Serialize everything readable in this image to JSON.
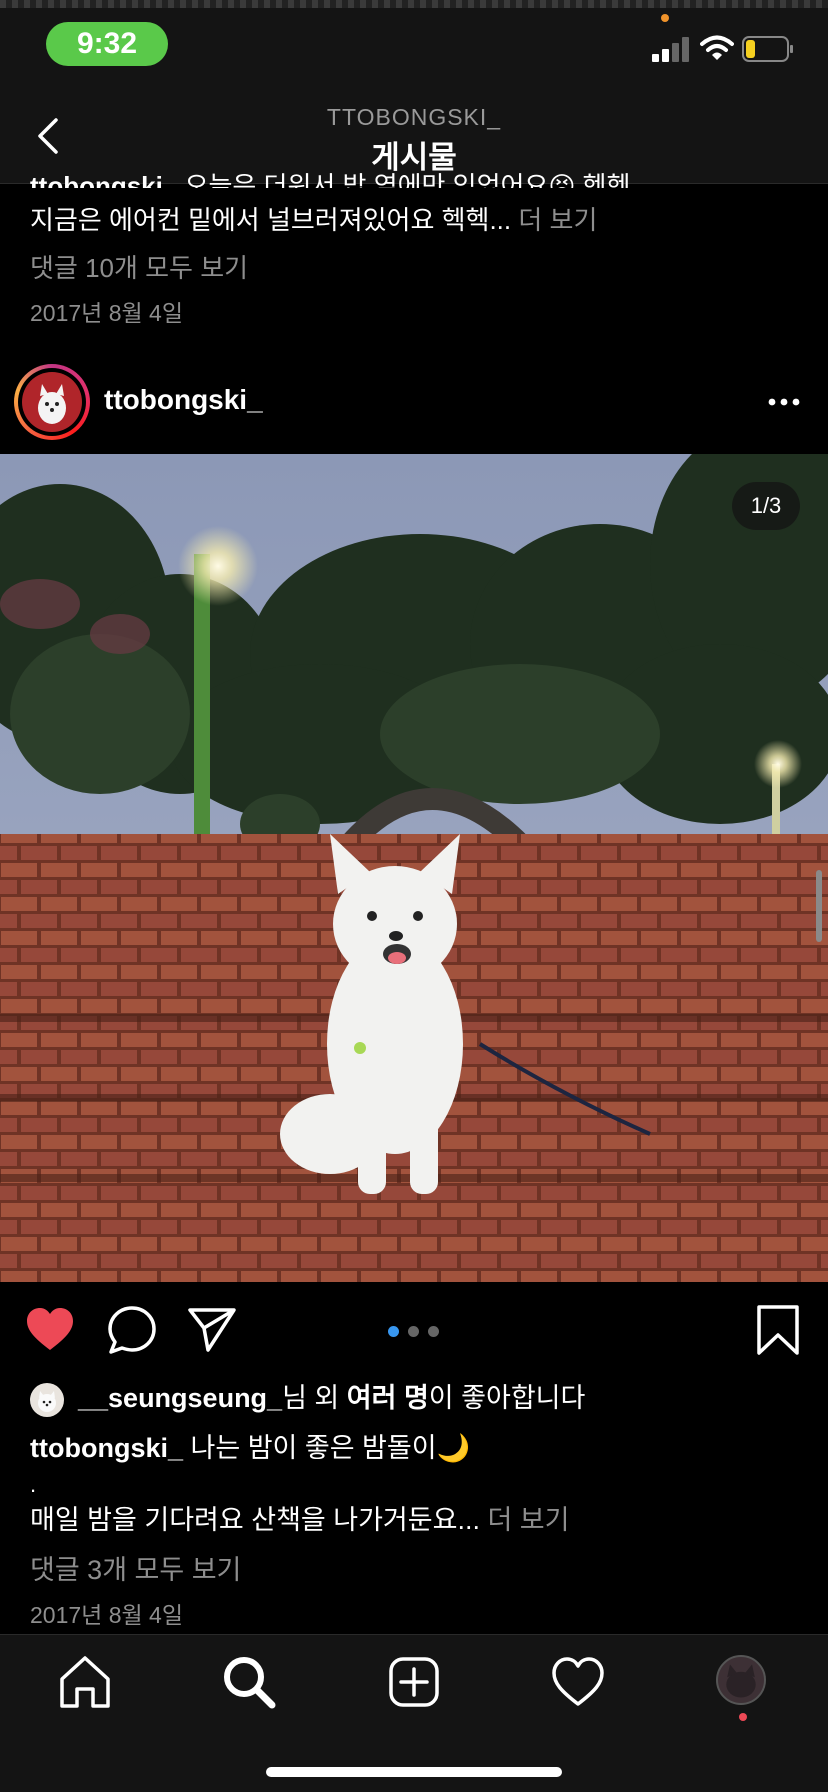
{
  "status_bar": {
    "time": "9:32",
    "battery_color": "#f5d020",
    "time_pill_color": "#5ac94a"
  },
  "header": {
    "username": "TTOBONGSKI_",
    "title": "게시물"
  },
  "prev_post": {
    "caption_cut_user": "ttobongski_",
    "caption_cut_text": "오늘은 더워서 밥 옆에만 있었어요😣 헥헥",
    "caption_line2": "지금은 에어컨 밑에서 널브러져있어요 헥헥...",
    "more_label": "더 보기",
    "comments_link": "댓글 10개 모두 보기",
    "date": "2017년 8월 4일"
  },
  "post": {
    "username": "ttobongski_",
    "photo_counter": "1/3",
    "carousel": {
      "total": 3,
      "active": 1,
      "active_color": "#3897f0"
    },
    "liked": true,
    "likes": {
      "user": "__seungseung_",
      "middle": "님 외 ",
      "bold": "여러 명",
      "suffix": "이 좋아합니다"
    },
    "caption": {
      "user": "ttobongski_",
      "line1": "나는 밤이 좋은 밤돌이🌙",
      "dot": ".",
      "line2": "매일 밤을 기다려요 산책을 나가거둔요...",
      "more_label": "더 보기"
    },
    "comments_link": "댓글 3개 모두 보기",
    "date": "2017년 8월 4일"
  },
  "tabs": [
    "home",
    "search",
    "new-post",
    "activity",
    "profile"
  ]
}
